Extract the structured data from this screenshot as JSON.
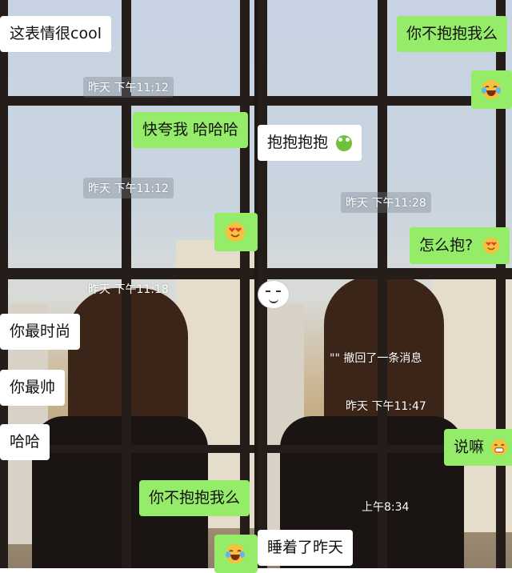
{
  "left_panel": {
    "messages": [
      {
        "text": "这表情很cool"
      },
      {
        "time": "昨天 下午11:12"
      },
      {
        "text": "快夸我 哈哈哈"
      },
      {
        "time": "昨天 下午11:12"
      },
      {
        "emoji": "heart-eyes-emoji"
      },
      {
        "time": "昨天 下午11:18"
      },
      {
        "text": "你最时尚"
      },
      {
        "text": "你最帅"
      },
      {
        "text": "哈哈"
      },
      {
        "text": "你不抱抱我么"
      },
      {
        "emoji": "laughing-tears-emoji"
      }
    ]
  },
  "right_panel": {
    "messages": [
      {
        "text": "你不抱抱我么"
      },
      {
        "emoji": "laughing-tears-emoji"
      },
      {
        "text": "抱抱抱抱"
      },
      {
        "time": "昨天 下午11:28"
      },
      {
        "text": "怎么抱?"
      },
      {
        "notice": "\"\" 撤回了一条消息"
      },
      {
        "time": "昨天 下午11:47"
      },
      {
        "text": "说嘛"
      },
      {
        "time": "上午8:34"
      },
      {
        "text": "睡着了昨天"
      }
    ]
  },
  "colors": {
    "bubble_green": "#95ec69",
    "bubble_white": "#ffffff",
    "window_frame": "#241d1a"
  }
}
